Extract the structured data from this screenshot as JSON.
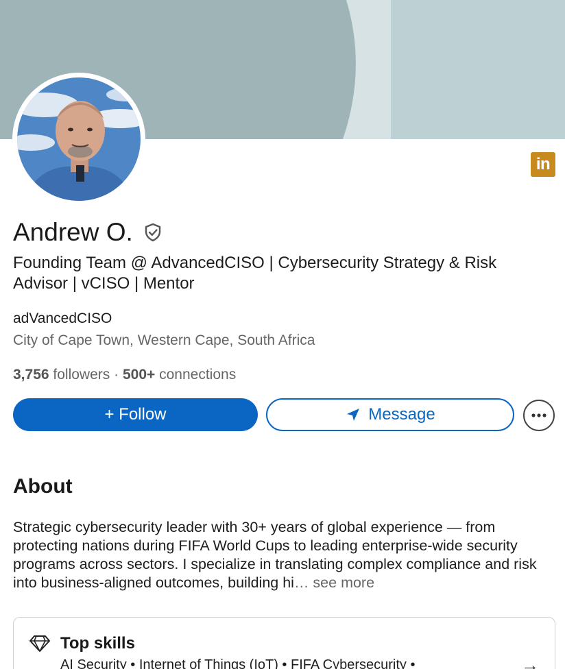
{
  "profile": {
    "name": "Andrew O.",
    "headline": "Founding Team @ AdvancedCISO | Cybersecurity Strategy & Risk Advisor | vCISO | Mentor",
    "company": "adVancedCISO",
    "location": "City of Cape Town, Western Cape, South Africa",
    "followers_count": "3,756",
    "followers_label": "followers",
    "separator": "·",
    "connections_count": "500+",
    "connections_label": "connections"
  },
  "actions": {
    "follow_label": "+ Follow",
    "message_label": "Message",
    "more_label": "···"
  },
  "badge": {
    "linkedin_text": "in"
  },
  "about": {
    "title": "About",
    "text": "Strategic cybersecurity leader with 30+ years of global experience — from protecting nations during FIFA World Cups to leading enterprise-wide security programs across sectors. I specialize in translating complex compliance and risk into business-aligned outcomes, building hi",
    "see_more": "… see more"
  },
  "skills": {
    "title": "Top skills",
    "list": "AI Security • Internet of Things (IoT) • FIFA Cybersecurity •",
    "arrow": "→"
  },
  "colors": {
    "accent": "#0a66c2",
    "banner_light": "#bfd0d4",
    "banner_dark": "#9fb4b7",
    "linkedin_badge": "#c78a1e"
  }
}
